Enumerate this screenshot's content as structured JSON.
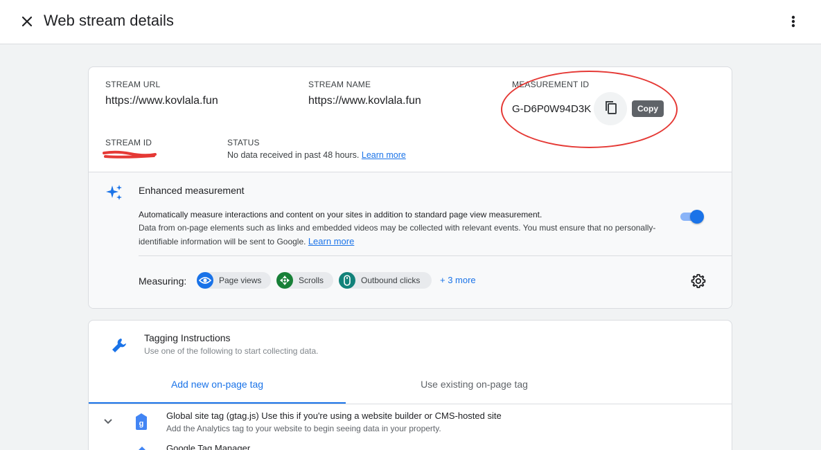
{
  "header": {
    "title": "Web stream details"
  },
  "stream": {
    "url_label": "STREAM URL",
    "url_value": "https://www.kovlala.fun",
    "name_label": "STREAM NAME",
    "name_value": "https://www.kovlala.fun",
    "measurement_label": "MEASUREMENT ID",
    "measurement_value": "G-D6P0W94D3K",
    "copy_tooltip": "Copy",
    "id_label": "STREAM ID",
    "status_label": "STATUS",
    "status_text": "No data received in past 48 hours.",
    "status_link": "Learn more"
  },
  "enhanced": {
    "title": "Enhanced measurement",
    "desc_line1": "Automatically measure interactions and content on your sites in addition to standard page view measurement.",
    "desc_line2": "Data from on-page elements such as links and embedded videos may be collected with relevant events. You must ensure that no personally-identifiable information will be sent to Google.",
    "learn_more": "Learn more",
    "toggle_on": true,
    "measuring_label": "Measuring:",
    "chips": [
      {
        "label": "Page views",
        "color": "#1a73e8"
      },
      {
        "label": "Scrolls",
        "color": "#188038"
      },
      {
        "label": "Outbound clicks",
        "color": "#12827a"
      }
    ],
    "more": "+ 3 more"
  },
  "tagging": {
    "title": "Tagging Instructions",
    "subtitle": "Use one of the following to start collecting data.",
    "tabs": [
      "Add new on-page tag",
      "Use existing on-page tag"
    ],
    "row1_title_bold": "Global site tag (gtag.js)",
    "row1_title_rest": " Use this if you're using a website builder or CMS-hosted site",
    "row1_sub": "Add the Analytics tag to your website to begin seeing data in your property.",
    "row2_title": "Google Tag Manager"
  },
  "colors": {
    "accent": "#1a73e8",
    "annotation_red": "#e53935"
  }
}
